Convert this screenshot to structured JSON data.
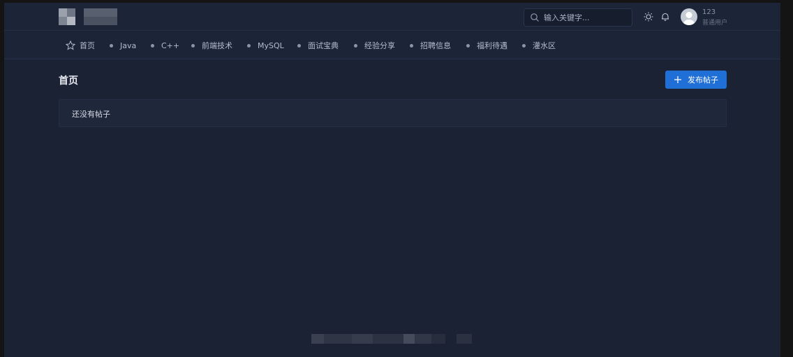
{
  "header": {
    "search_placeholder": "输入关键字...",
    "user": {
      "name": "123",
      "role": "普通用户"
    }
  },
  "nav": {
    "items": [
      {
        "label": "首页",
        "icon": "star-icon"
      },
      {
        "label": "Java",
        "icon": "dot"
      },
      {
        "label": "C++",
        "icon": "dot"
      },
      {
        "label": "前端技术",
        "icon": "dot"
      },
      {
        "label": "MySQL",
        "icon": "dot"
      },
      {
        "label": "面试宝典",
        "icon": "dot"
      },
      {
        "label": "经验分享",
        "icon": "dot"
      },
      {
        "label": "招聘信息",
        "icon": "dot"
      },
      {
        "label": "福利待遇",
        "icon": "dot"
      },
      {
        "label": "灌水区",
        "icon": "dot"
      }
    ]
  },
  "main": {
    "title": "首页",
    "post_button_label": "发布帖子",
    "empty_text": "还没有帖子"
  },
  "colors": {
    "background": "#1b2233",
    "header": "#1c2438",
    "accent": "#1f6fd6"
  }
}
